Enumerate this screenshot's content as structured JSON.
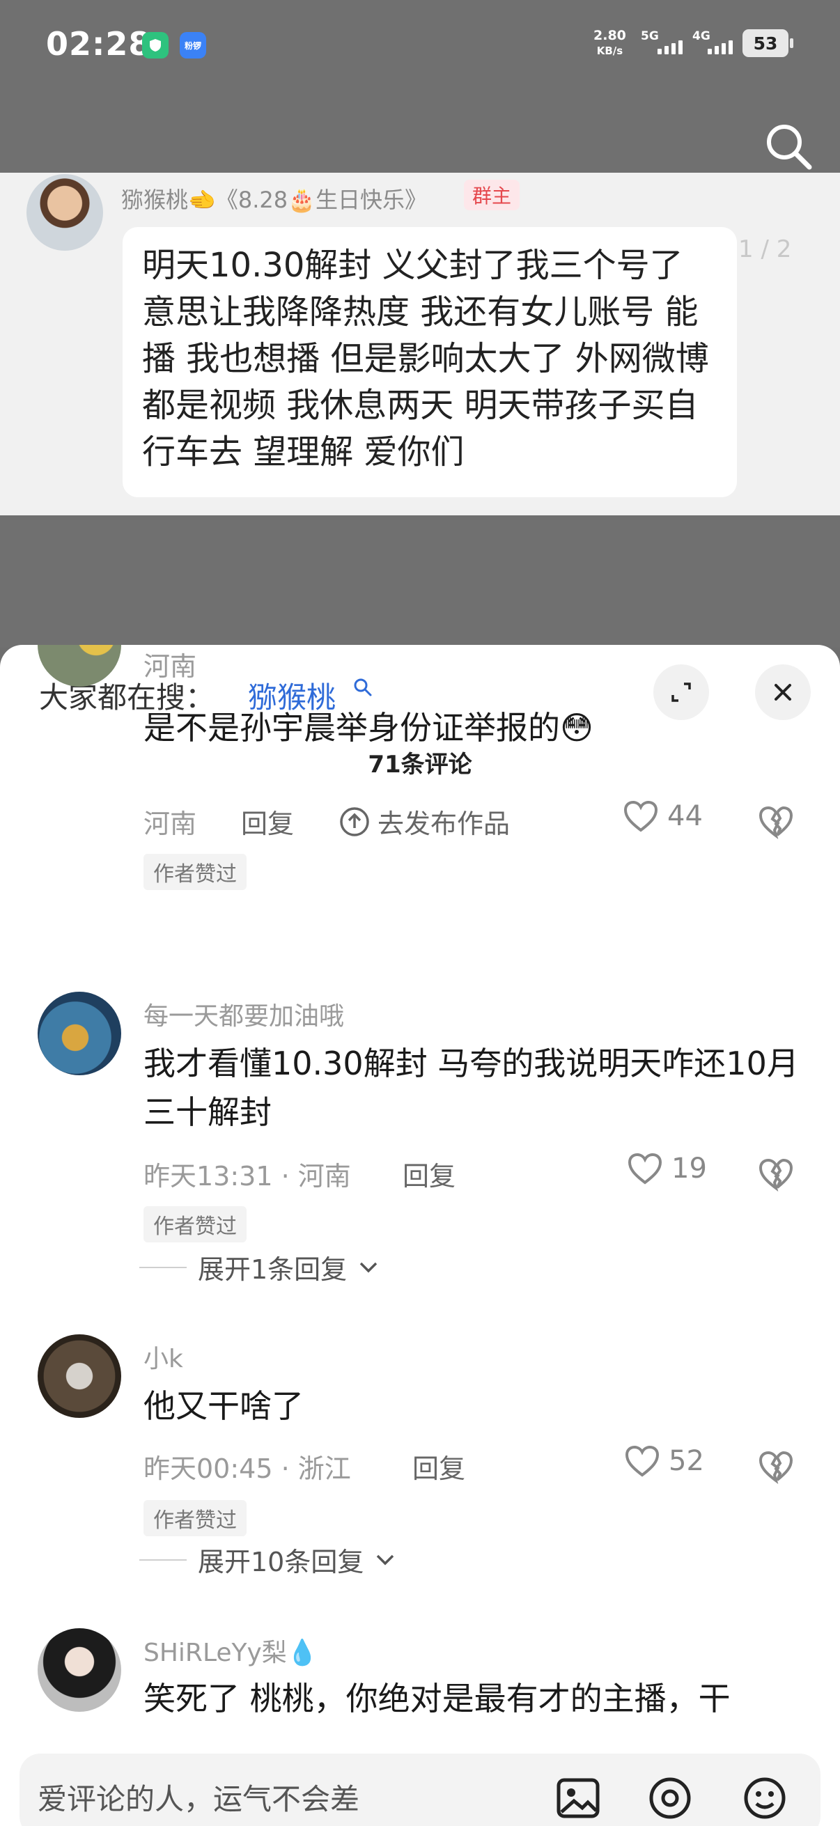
{
  "status_bar": {
    "time": "02:28",
    "app1": "",
    "app2": "粉锣",
    "speed_value": "2.80",
    "speed_unit": "KB/s",
    "net1": "5G",
    "net2": "4G",
    "battery": "53"
  },
  "chat": {
    "sender": "猕猴桃🫲《8.28🎂生日快乐》",
    "badge": "群主",
    "page_indicator": "1 / 2",
    "message": "明天10.30解封 义父封了我三个号了 意思让我降降热度 我还有女儿账号 能播 我也想播 但是影响太大了 外网微博都是视频 我休息两天 明天带孩子买自行车去 望理解 爱你们"
  },
  "sheet": {
    "hot_search_label": "大家都在搜：",
    "hot_search_term": "猕猴桃",
    "comment_count": "71条评论"
  },
  "comments": [
    {
      "author": "",
      "text": "是不是孙宇晨举身份证举报的😳",
      "location": "河南",
      "reply": "回复",
      "publish": "去发布作品",
      "likes": "44",
      "badge": "作者赞过",
      "expand": ""
    },
    {
      "author": "每一天都要加油哦",
      "text": "我才看懂10.30解封 马夸的我说明天咋还10月三十解封",
      "meta": "昨天13:31 · 河南",
      "reply": "回复",
      "likes": "19",
      "badge": "作者赞过",
      "expand": "展开1条回复"
    },
    {
      "author": "小k",
      "text": "他又干啥了",
      "meta": "昨天00:45 · 浙江",
      "reply": "回复",
      "likes": "52",
      "badge": "作者赞过",
      "expand": "展开10条回复"
    },
    {
      "author": "SHiRLeYy梨💧",
      "text": "笑死了 桃桃，你绝对是最有才的主播，干"
    }
  ],
  "input": {
    "placeholder": "爱评论的人，运气不会差"
  },
  "icons": {
    "accent": "#2f6bd8",
    "badge_red": "#e5484d"
  }
}
